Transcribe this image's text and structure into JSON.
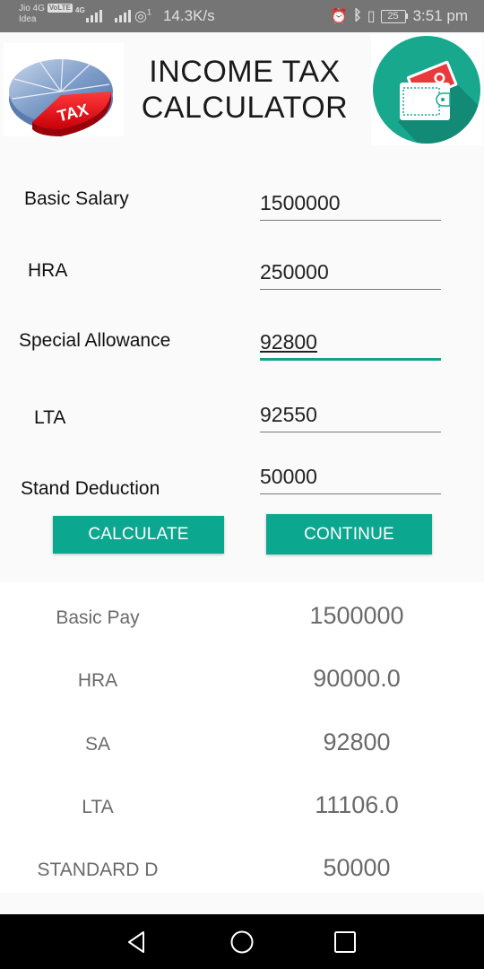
{
  "status_bar": {
    "carrier_1": "Jio 4G",
    "volte_badge": "VoLTE",
    "carrier_2": "Idea",
    "network_type": "4G",
    "hotspot_count": "1",
    "data_speed": "14.3K/s",
    "battery_level": "25",
    "time": "3:51 pm",
    "icons": [
      "alarm-icon",
      "bluetooth-icon",
      "vibrate-icon",
      "battery-icon"
    ]
  },
  "header": {
    "title_line1": "INCOME TAX",
    "title_line2": "CALCULATOR",
    "left_logo": "tax-pie-chart-logo",
    "left_logo_text": "TAX",
    "right_logo": "wallet-money-icon"
  },
  "form": {
    "fields": [
      {
        "label": "Basic Salary",
        "value": "1500000"
      },
      {
        "label": "HRA",
        "value": "250000"
      },
      {
        "label": "Special Allowance",
        "value": "92800"
      },
      {
        "label": "LTA",
        "value": "92550"
      },
      {
        "label": "Stand Deduction",
        "value": "50000"
      }
    ],
    "calculate_label": "CALCULATE",
    "continue_label": "CONTINUE"
  },
  "results": {
    "rows": [
      {
        "label": "Basic Pay",
        "value": "1500000"
      },
      {
        "label": "HRA",
        "value": "90000.0"
      },
      {
        "label": "SA",
        "value": "92800"
      },
      {
        "label": "LTA",
        "value": "11106.0"
      },
      {
        "label": "STANDARD D",
        "value": "50000"
      }
    ]
  },
  "colors": {
    "accent": "#0ca78f",
    "status_bar": "#757575",
    "background": "#fafafa",
    "wallet_circle": "#17a88e",
    "tax_red": "#e8141c"
  }
}
